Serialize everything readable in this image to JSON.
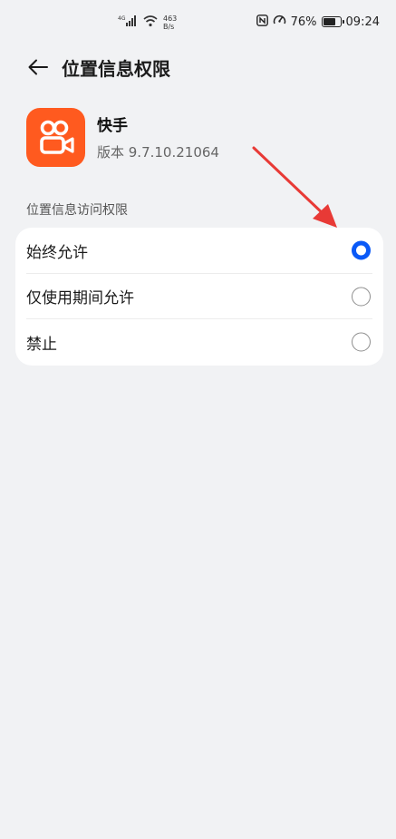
{
  "status_bar": {
    "signal_label": "4G",
    "net_speed_value": "463",
    "net_speed_unit": "B/s",
    "battery": "76%",
    "battery_level": 0.76,
    "time": "09:24"
  },
  "header": {
    "title": "位置信息权限"
  },
  "app": {
    "name": "快手",
    "version": "版本 9.7.10.21064",
    "icon_color": "#ff5a1f"
  },
  "section": {
    "label": "位置信息访问权限"
  },
  "options": [
    {
      "label": "始终允许",
      "selected": true
    },
    {
      "label": "仅使用期间允许",
      "selected": false
    },
    {
      "label": "禁止",
      "selected": false
    }
  ],
  "colors": {
    "accent": "#0a59f7",
    "annotation": "#e83a36"
  }
}
